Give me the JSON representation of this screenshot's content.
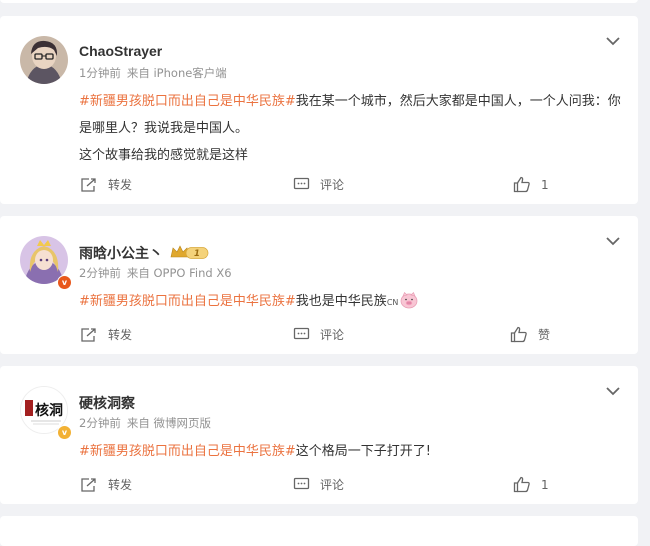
{
  "colors": {
    "tag": "#eb7340",
    "page_bg": "#f1f2f5",
    "card_bg": "#ffffff",
    "meta": "#939393"
  },
  "posts": [
    {
      "name": "ChaoStrayer",
      "time": "1分钟前",
      "source": "来自 iPhone客户端",
      "hashtag": "#新疆男孩脱口而出自己是中华民族#",
      "text_line1": "我在某一个城市，然后大家都是中国人，一个人问我：你是哪里人？我说我是中国人。",
      "text_line2": "这个故事给我的感觉就是这样",
      "repost_label": "转发",
      "comment_label": "评论",
      "like_label": "1",
      "avatar_icon": "avatar-illustration-icon"
    },
    {
      "name": "雨晗小公主丶",
      "level_badge": "1",
      "time": "2分钟前",
      "source": "来自 OPPO Find X6",
      "hashtag": "#新疆男孩脱口而出自己是中华民族#",
      "text": "我也是中华民族",
      "emoji_suffix": "CN",
      "repost_label": "转发",
      "comment_label": "评论",
      "like_label": "赞",
      "avatar_icon": "avatar-princess-icon"
    },
    {
      "name": "硬核洞察",
      "time": "2分钟前",
      "source": "来自 微博网页版",
      "hashtag": "#新疆男孩脱口而出自己是中华民族#",
      "text": "这个格局一下子打开了!",
      "repost_label": "转发",
      "comment_label": "评论",
      "like_label": "1",
      "avatar_icon": "avatar-calligraphy-logo-icon",
      "avatar_text": "核洞"
    }
  ]
}
